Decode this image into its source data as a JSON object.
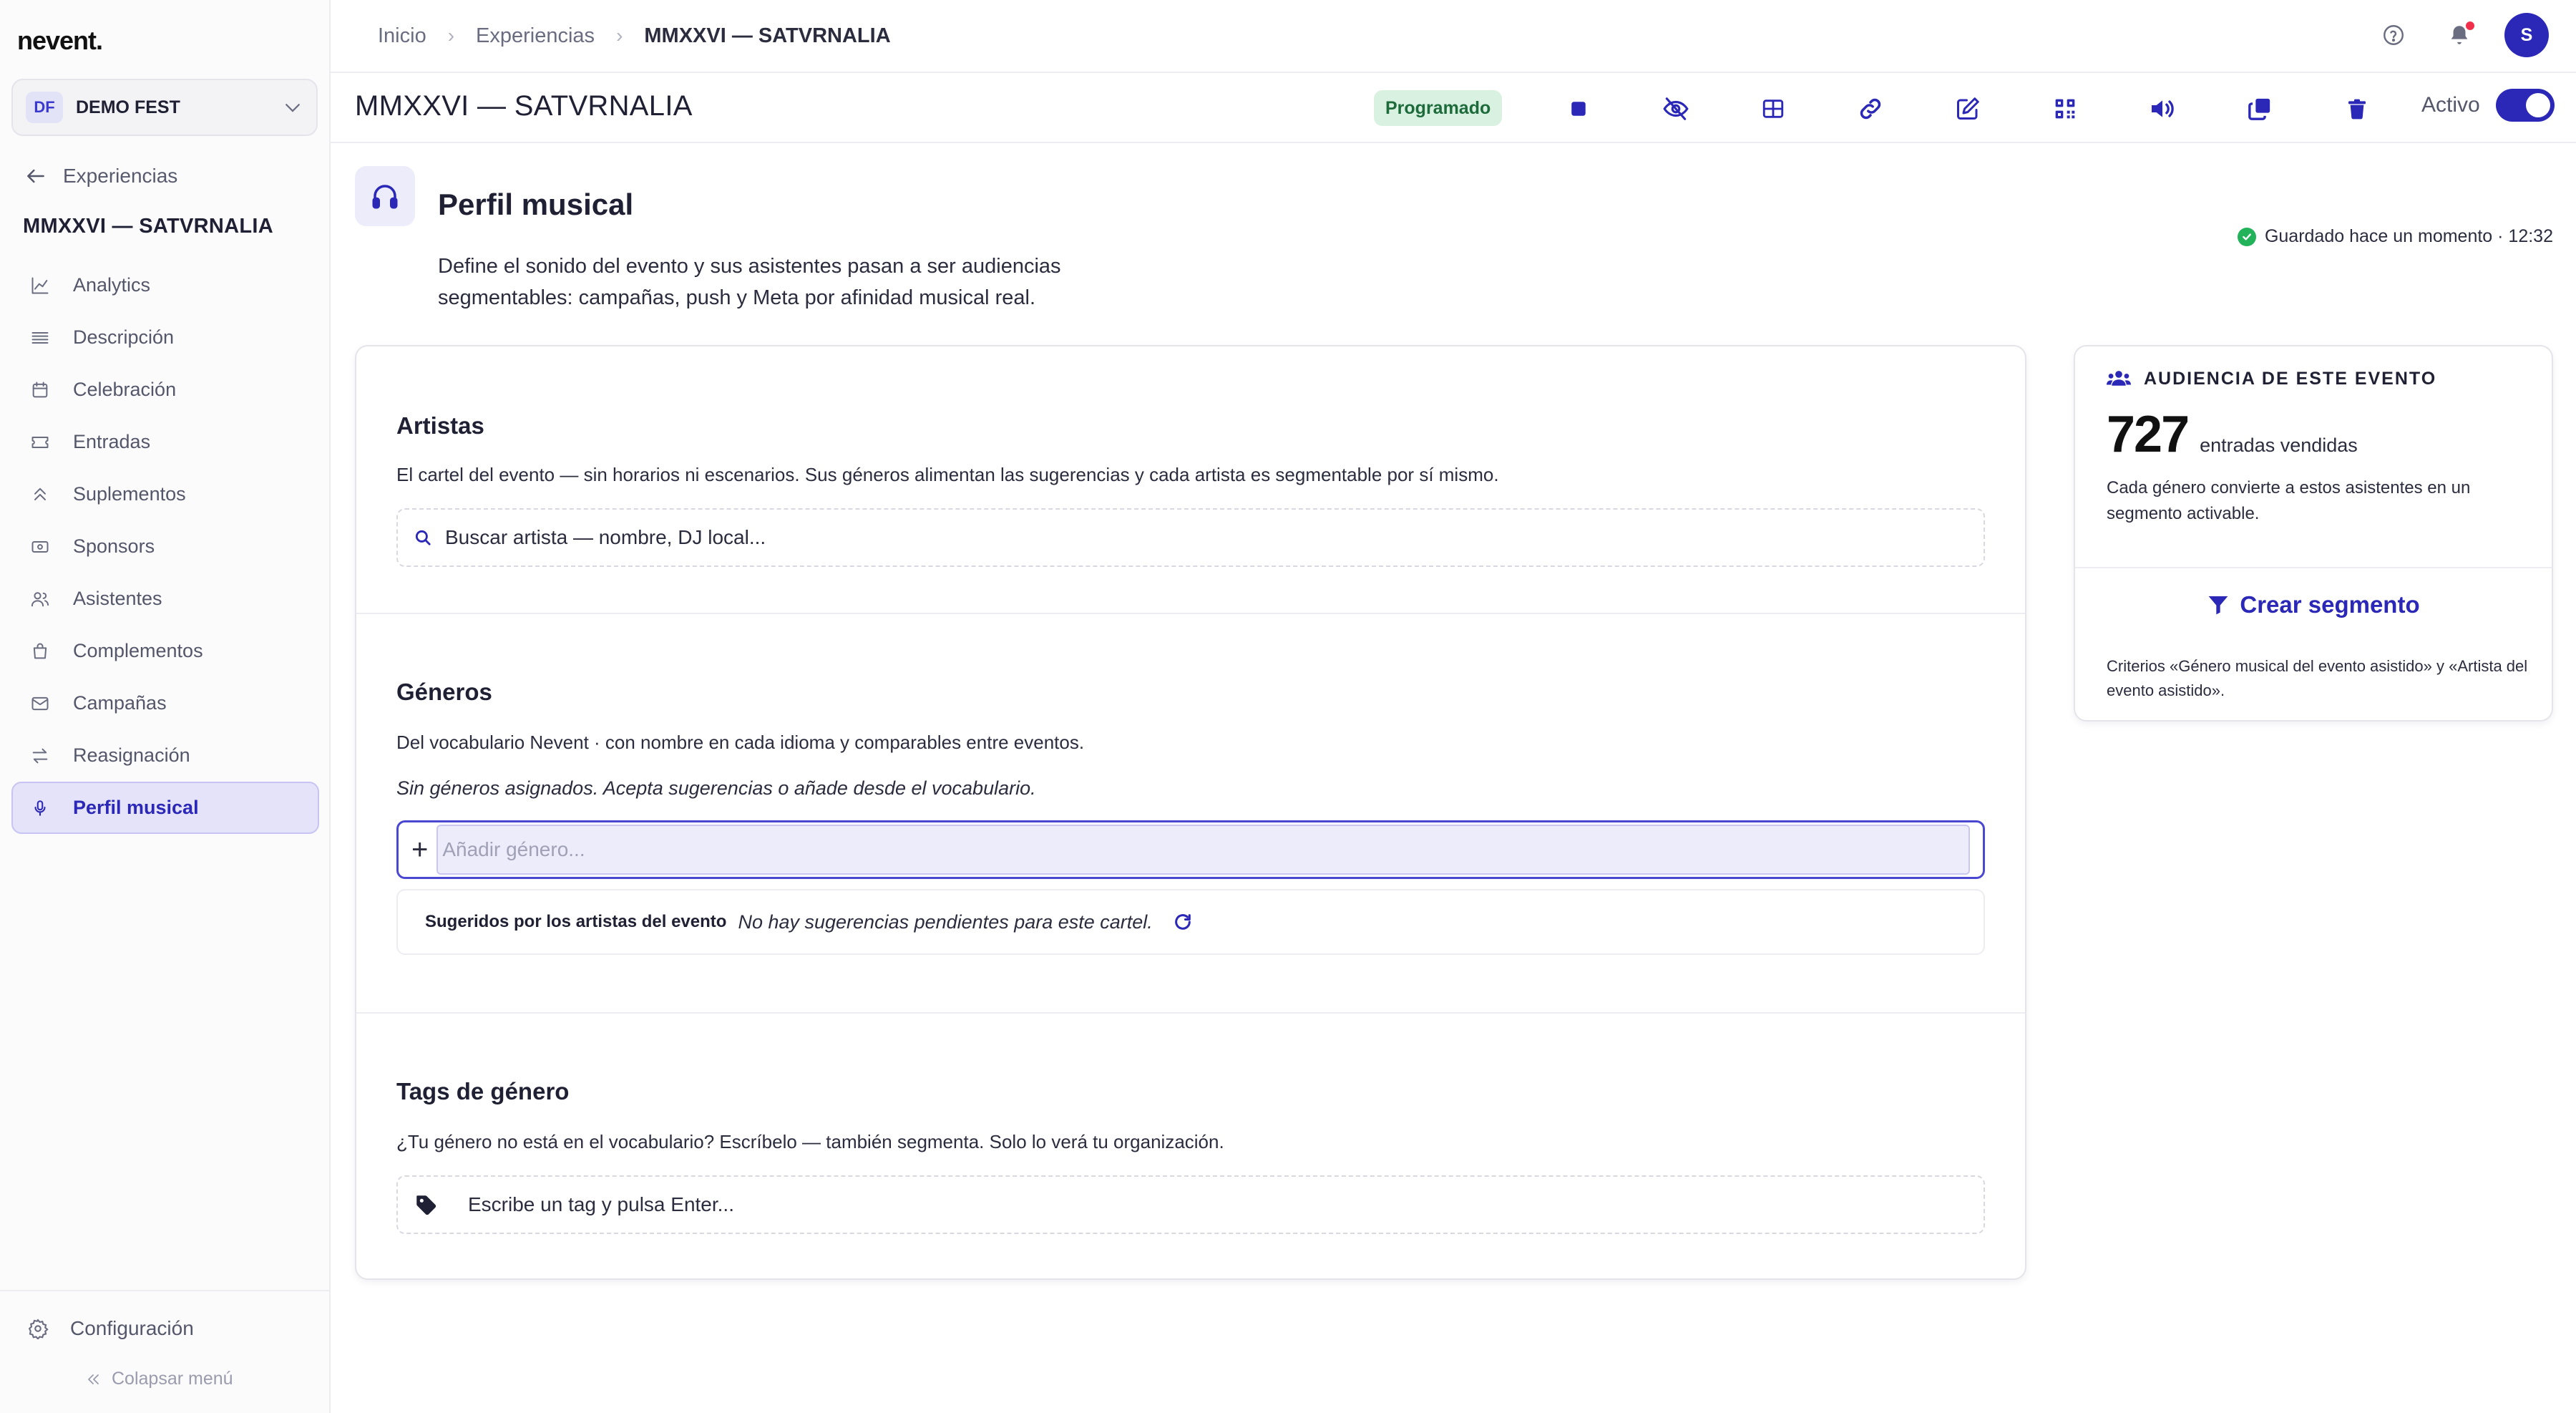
{
  "app": {
    "logo": "nevent."
  },
  "org": {
    "badge": "DF",
    "name": "DEMO FEST"
  },
  "sidebar": {
    "back_label": "Experiencias",
    "event_title": "MMXXVI — SATVRNALIA",
    "items": [
      {
        "label": "Analytics",
        "icon": "chart-line-icon"
      },
      {
        "label": "Descripción",
        "icon": "text-lines-icon"
      },
      {
        "label": "Celebración",
        "icon": "calendar-icon"
      },
      {
        "label": "Entradas",
        "icon": "ticket-icon"
      },
      {
        "label": "Suplementos",
        "icon": "chevrons-up-icon"
      },
      {
        "label": "Sponsors",
        "icon": "banknote-icon"
      },
      {
        "label": "Asistentes",
        "icon": "users-icon"
      },
      {
        "label": "Complementos",
        "icon": "shopping-bag-icon"
      },
      {
        "label": "Campañas",
        "icon": "mail-icon"
      },
      {
        "label": "Reasignación",
        "icon": "arrows-swap-icon"
      },
      {
        "label": "Perfil musical",
        "icon": "microphone-icon",
        "active": true
      }
    ],
    "config_label": "Configuración",
    "collapse_label": "Colapsar menú"
  },
  "breadcrumb": [
    "Inicio",
    "Experiencias",
    "MMXXVI — SATVRNALIA"
  ],
  "header": {
    "user_initial": "S",
    "page_title": "MMXXVI — SATVRNALIA",
    "status": "Programado",
    "active_label": "Activo",
    "active": true,
    "actions": [
      "stop-icon",
      "eye-off-icon",
      "table-icon",
      "link-icon",
      "edit-icon",
      "qr-code-icon",
      "volume-icon",
      "copy-icon",
      "trash-icon"
    ]
  },
  "section": {
    "title": "Perfil musical",
    "description": "Define el sonido del evento y sus asistentes pasan a ser audiencias segmentables: campañas, push y Meta por afinidad musical real.",
    "saved": "Guardado hace un momento · 12:32"
  },
  "artists": {
    "title": "Artistas",
    "description": "El cartel del evento — sin horarios ni escenarios. Sus géneros alimentan las sugerencias y cada artista es segmentable por sí mismo.",
    "search_placeholder": "Buscar artista — nombre, DJ local..."
  },
  "genres": {
    "title": "Géneros",
    "description": "Del vocabulario Nevent · con nombre en cada idioma y comparables entre eventos.",
    "empty_note": "Sin géneros asignados. Acepta sugerencias o añade desde el vocabulario.",
    "add_placeholder": "Añadir género...",
    "suggest_label": "Sugeridos por los artistas del evento",
    "suggest_empty": "No hay sugerencias pendientes para este cartel."
  },
  "tags": {
    "title": "Tags de género",
    "description": "¿Tu género no está en el vocabulario? Escríbelo — también segmenta. Solo lo verá tu organización.",
    "input_placeholder": "Escribe un tag y pulsa Enter..."
  },
  "audience": {
    "heading": "AUDIENCIA DE ESTE EVENTO",
    "count": "727",
    "count_label": "entradas vendidas",
    "description": "Cada género convierte a estos asistentes en un segmento activable.",
    "create_segment": "Crear segmento",
    "criteria": "Criterios «Género musical del evento asistido» y «Artista del evento asistido»."
  },
  "colors": {
    "accent": "#2b28b8",
    "status_bg": "#d8f1e0",
    "status_fg": "#1d6b3b",
    "success": "#22b35a",
    "alert": "#f0304a"
  }
}
